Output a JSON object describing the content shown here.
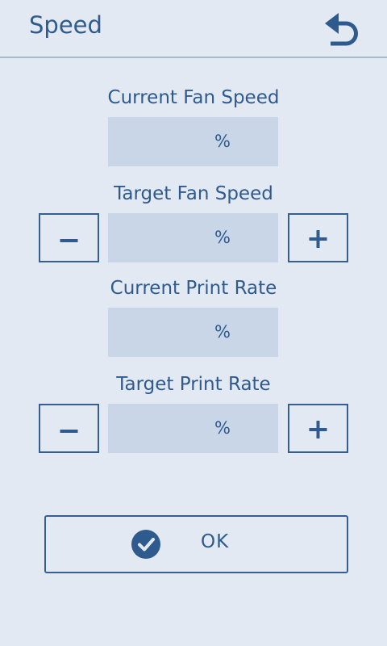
{
  "header": {
    "title": "Speed",
    "back_icon": "back-arrow-icon"
  },
  "fields": {
    "current_fan_speed": {
      "label": "Current Fan Speed",
      "unit": "%"
    },
    "target_fan_speed": {
      "label": "Target Fan Speed",
      "unit": "%"
    },
    "current_print_rate": {
      "label": "Current Print Rate",
      "unit": "%"
    },
    "target_print_rate": {
      "label": "Target Print Rate",
      "unit": "%"
    }
  },
  "buttons": {
    "minus_icon": "minus-icon",
    "plus_icon": "plus-icon",
    "ok_label": "OK",
    "ok_icon": "check-circle-icon"
  },
  "colors": {
    "background": "#e3e9f3",
    "accent": "#2e5a8e",
    "field": "#c9d6e8"
  }
}
